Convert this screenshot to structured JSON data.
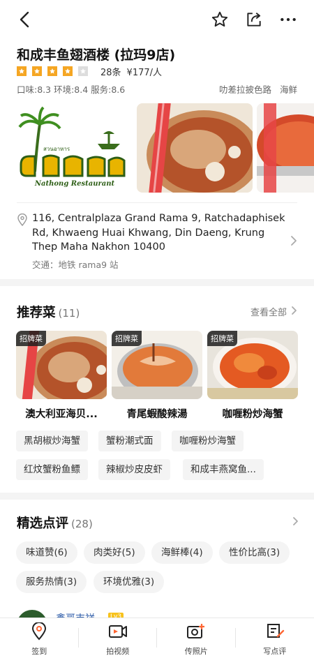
{
  "restaurant": {
    "name": "和成丰鱼翅酒楼 (拉玛9店)",
    "rating_stars": 4,
    "review_count": "28条",
    "price": "¥177/人",
    "scores": "口味:8.3 环境:8.4 服务:8.6",
    "tags": [
      "叻差拉披色路",
      "海鲜"
    ],
    "logo_text": "Nathong Restaurant"
  },
  "address": {
    "text": "116, Centralplaza Grand Rama 9, Ratchadaphisek Rd, Khwaeng Huai Khwang, Din Daeng, Krung Thep Maha Nakhon 10400",
    "transit": "交通：地铁 rama9 站"
  },
  "recommended": {
    "title": "推荐菜",
    "count": "(11)",
    "see_all": "查看全部",
    "badge": "招牌菜",
    "dishes": [
      {
        "name": "澳大利亚海贝..."
      },
      {
        "name": "青尾蝦酸辣湯"
      },
      {
        "name": "咖喱粉炒海蟹"
      }
    ],
    "chips": [
      "黑胡椒炒海蟹",
      "蟹粉潮式面",
      "咖喱粉炒海蟹",
      "红炆蟹粉鱼鳔",
      "辣椒炒皮皮虾",
      "和成丰燕窝鱼..."
    ]
  },
  "reviews": {
    "title": "精选点评",
    "count": "(28)",
    "pills": [
      "味道赞(6)",
      "肉类好(5)",
      "海鲜棒(4)",
      "性价比高(3)",
      "服务热情(3)",
      "环境优雅(3)"
    ],
    "first_reviewer": "鑫哥吉祥",
    "first_level": "Lv3"
  },
  "bottom_bar": [
    {
      "label": "签到",
      "icon": "location-pin-icon"
    },
    {
      "label": "拍视频",
      "icon": "video-camera-icon"
    },
    {
      "label": "传照片",
      "icon": "photo-upload-icon"
    },
    {
      "label": "写点评",
      "icon": "write-review-icon"
    }
  ],
  "colors": {
    "star_active": "#f5a623",
    "star_inactive": "#dddddd",
    "accent": "#ff6633",
    "link": "#2b5aa8"
  }
}
